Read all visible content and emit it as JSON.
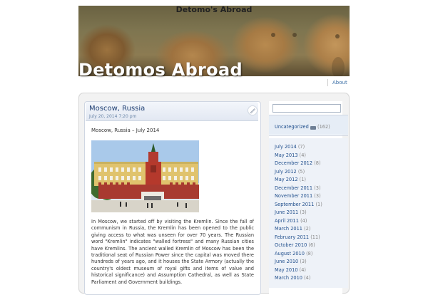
{
  "header": {
    "site_title_small": "Detomo's Abroad",
    "site_title_large": "Detomos Abroad"
  },
  "nav": {
    "about_label": "About"
  },
  "post": {
    "title": "Moscow, Russia",
    "date": "July 20, 2014 7:20 pm",
    "subtitle": "Moscow, Russia – July 2014",
    "body": "In Moscow, we started off by visiting the Kremlin.  Since the fall of communism in Russia, the Kremlin has been opened to the public giving access to what was unseen for over 70 years.  The Russian word \"Kremlin\" indicates \"walled fortress\" and many Russian cities have Kremlins. The ancient walled Kremlin of Moscow has been the traditional seat of Russian Power since the capital was moved there hundreds of years ago, and it houses the State Armory (actually the country's oldest museum of royal gifts and items of value and historical significance) and Assumption Cathedral, as well as State Parliament and Government buildings."
  },
  "sidebar": {
    "search_placeholder": "",
    "category": {
      "label": "Uncategorized",
      "count": "(162)"
    },
    "archives": [
      {
        "label": "July 2014",
        "count": "(7)"
      },
      {
        "label": "May 2013",
        "count": "(4)"
      },
      {
        "label": "December 2012",
        "count": "(8)"
      },
      {
        "label": "July 2012",
        "count": "(5)"
      },
      {
        "label": "May 2012",
        "count": "(1)"
      },
      {
        "label": "December 2011",
        "count": "(3)"
      },
      {
        "label": "November 2011",
        "count": "(3)"
      },
      {
        "label": "September 2011",
        "count": "(1)"
      },
      {
        "label": "June 2011",
        "count": "(3)"
      },
      {
        "label": "April 2011",
        "count": "(4)"
      },
      {
        "label": "March 2011",
        "count": "(2)"
      },
      {
        "label": "February 2011",
        "count": "(11)"
      },
      {
        "label": "October 2010",
        "count": "(6)"
      },
      {
        "label": "August 2010",
        "count": "(8)"
      },
      {
        "label": "June 2010",
        "count": "(3)"
      },
      {
        "label": "May 2010",
        "count": "(4)"
      },
      {
        "label": "March 2010",
        "count": "(4)"
      }
    ]
  },
  "icons": {
    "edit": "pencil-icon",
    "feed": "rss-icon"
  },
  "colors": {
    "link": "#1f4e8c",
    "post_title": "#1f3f73",
    "sidebar_bg": "#eef2f8"
  }
}
